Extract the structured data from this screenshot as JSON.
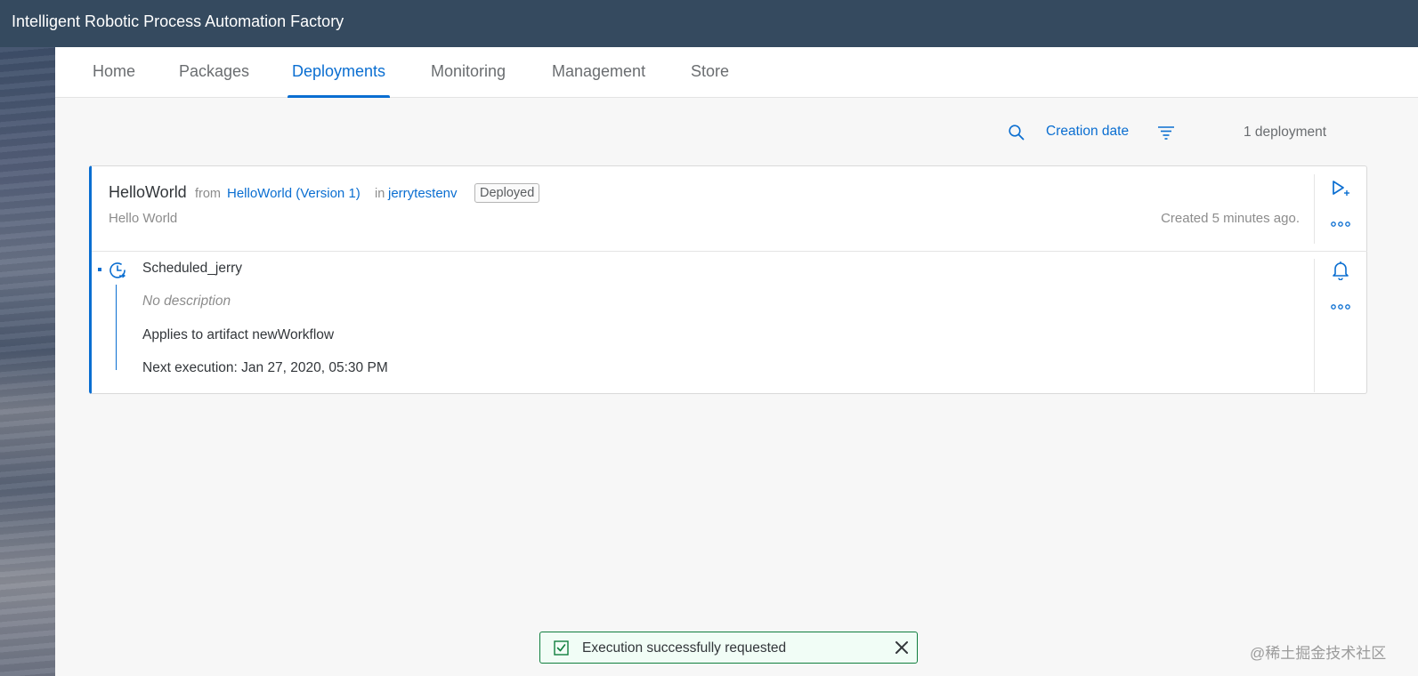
{
  "app": {
    "title": "Intelligent Robotic Process Automation Factory"
  },
  "tabs": [
    {
      "label": "Home"
    },
    {
      "label": "Packages"
    },
    {
      "label": "Deployments",
      "active": true
    },
    {
      "label": "Monitoring"
    },
    {
      "label": "Management"
    },
    {
      "label": "Store"
    }
  ],
  "toolbar": {
    "search_icon": "search-icon",
    "sort_label": "Creation date",
    "sort_icon": "sort-icon",
    "count_label": "1 deployment"
  },
  "deployment": {
    "name": "HelloWorld",
    "from_word": "from",
    "package_link": "HelloWorld (Version 1)",
    "in_word": "in",
    "environment_link": "jerrytestenv",
    "status": "Deployed",
    "description": "Hello World",
    "created": "Created 5 minutes ago.",
    "run_icon": "run-play-icon",
    "more_icon": "more-icon"
  },
  "trigger": {
    "icon": "clock-icon",
    "name": "Scheduled_jerry",
    "description": "No description",
    "artifact": "Applies to artifact newWorkflow",
    "next_execution": "Next execution: Jan 27, 2020, 05:30 PM",
    "bell_icon": "bell-icon",
    "more_icon": "more-icon"
  },
  "toast": {
    "message": "Execution successfully requested",
    "icon": "check-icon",
    "close_icon": "close-icon"
  },
  "watermark": "@稀土掘金技术社区",
  "colors": {
    "shellbar": "#354a5f",
    "accent": "#0a6ed1",
    "success": "#107e3e"
  }
}
